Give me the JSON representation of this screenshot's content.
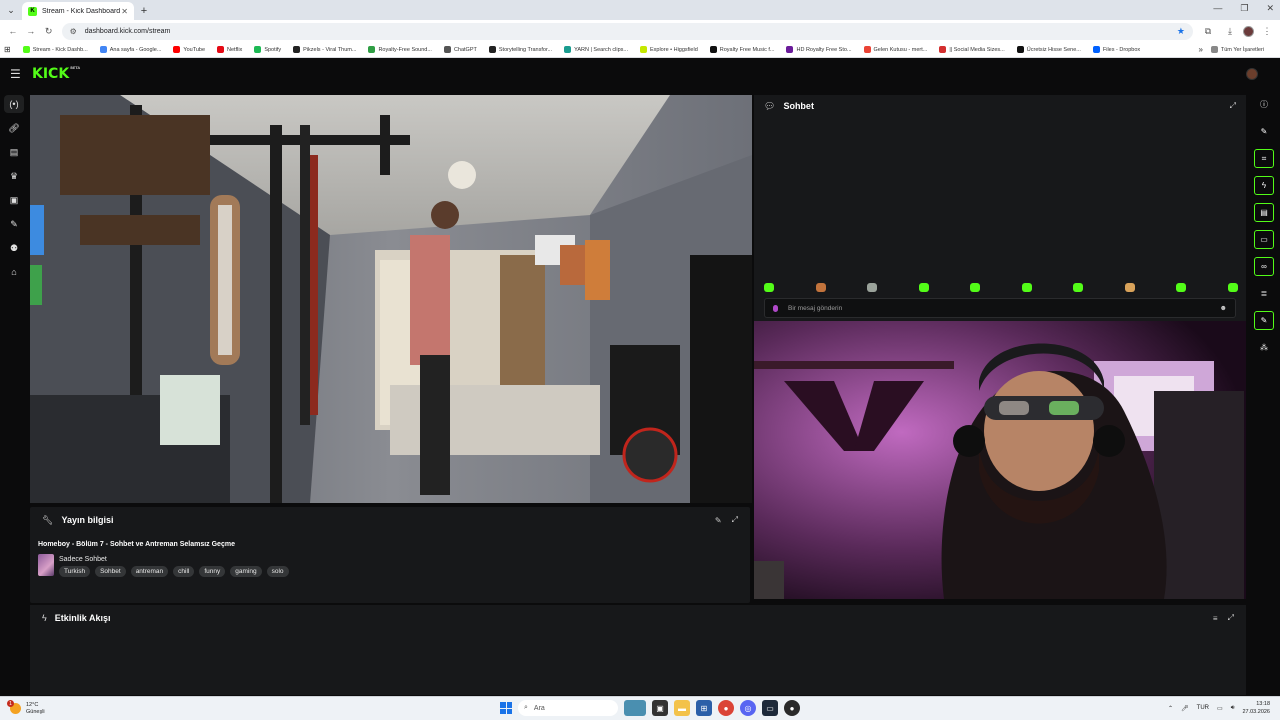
{
  "browser": {
    "tab_title": "Stream - Kick Dashboard",
    "new_tab": "+",
    "url": "dashboard.kick.com/stream",
    "bookmarks": [
      {
        "label": "Stream - Kick Dashb...",
        "color": "#53fc18"
      },
      {
        "label": "Ana sayfa - Google...",
        "color": "#4285f4"
      },
      {
        "label": "YouTube",
        "color": "#ff0000"
      },
      {
        "label": "Netflix",
        "color": "#e50914"
      },
      {
        "label": "Spotify",
        "color": "#1db954"
      },
      {
        "label": "Pikzels - Viral Thum...",
        "color": "#222222"
      },
      {
        "label": "Royalty-Free Sound...",
        "color": "#2f9e44"
      },
      {
        "label": "ChatGPT",
        "color": "#555555"
      },
      {
        "label": "Storytelling Transfor...",
        "color": "#222222"
      },
      {
        "label": "YARN | Search clips...",
        "color": "#1a9c8f"
      },
      {
        "label": "Explore • Higgsfield",
        "color": "#c5e800"
      },
      {
        "label": "Royalty Free Music f...",
        "color": "#111111"
      },
      {
        "label": "HD Royalty Free Sto...",
        "color": "#6a1b9a"
      },
      {
        "label": "Gelen Kutusu - mert...",
        "color": "#ea4335"
      },
      {
        "label": "|| Social Media Sizes...",
        "color": "#d32f2f"
      },
      {
        "label": "Ücretsiz Hisse Sene...",
        "color": "#111111"
      },
      {
        "label": "Files - Dropbox",
        "color": "#0061ff"
      }
    ],
    "bookmarks_more": "»",
    "all_bookmarks": "Tüm Yer İşaretleri"
  },
  "app": {
    "logo": "KICK",
    "logo_beta": "BETA",
    "accent": "#53fc18",
    "stream_info": {
      "heading": "Yayın bilgisi",
      "title": "Homeboy - Bölüm 7 - Sohbet ve Antreman Selamsız Geçme",
      "category": "Sadece Sohbet",
      "tags": [
        "Turkish",
        "Sohbet",
        "antreman",
        "chill",
        "funny",
        "gaming",
        "solo"
      ]
    },
    "chat": {
      "heading": "Sohbet",
      "placeholder": "Bir mesaj gönderin"
    },
    "activity": {
      "heading": "Etkinlik Akışı"
    }
  },
  "taskbar": {
    "temp": "12°C",
    "weather": "Güneşli",
    "notification_count": "1",
    "search": "Ara",
    "lang": "TUR",
    "time": "13:18",
    "date": "27.03.2026"
  }
}
